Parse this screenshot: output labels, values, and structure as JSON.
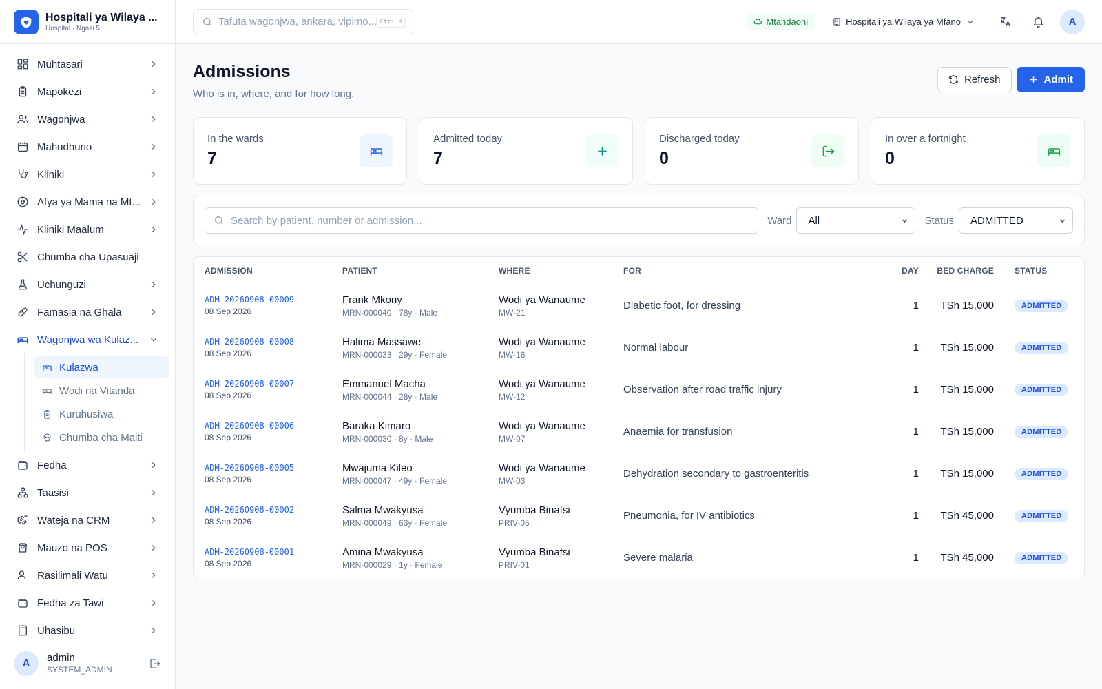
{
  "brand": {
    "title": "Hospitali ya Wilaya ...",
    "subtitle": "Hospital · Ngazi 5"
  },
  "sidebar": {
    "items": [
      {
        "label": "Muhtasari",
        "icon": "dashboard-icon"
      },
      {
        "label": "Mapokezi",
        "icon": "clipboard-icon"
      },
      {
        "label": "Wagonjwa",
        "icon": "users-icon"
      },
      {
        "label": "Mahudhurio",
        "icon": "calendar-icon"
      },
      {
        "label": "Kliniki",
        "icon": "stethoscope-icon"
      },
      {
        "label": "Afya ya Mama na Mt...",
        "icon": "baby-icon"
      },
      {
        "label": "Kliniki Maalum",
        "icon": "activity-icon"
      },
      {
        "label": "Chumba cha Upasuaji",
        "icon": "scissors-icon"
      },
      {
        "label": "Uchunguzi",
        "icon": "flask-icon"
      },
      {
        "label": "Famasia na Ghala",
        "icon": "pill-icon"
      },
      {
        "label": "Wagonjwa wa Kulaz...",
        "icon": "bed-icon"
      }
    ],
    "subitems": [
      {
        "label": "Kulazwa",
        "icon": "bed-icon"
      },
      {
        "label": "Wodi na Vitanda",
        "icon": "bed-icon"
      },
      {
        "label": "Kuruhusiwa",
        "icon": "clipboard-icon"
      },
      {
        "label": "Chumba cha Maiti",
        "icon": "skull-icon"
      }
    ],
    "items_after": [
      {
        "label": "Fedha",
        "icon": "wallet-icon"
      },
      {
        "label": "Taasisi",
        "icon": "network-icon"
      },
      {
        "label": "Wateja na CRM",
        "icon": "handshake-icon"
      },
      {
        "label": "Mauzo na POS",
        "icon": "shopping-bag-icon"
      },
      {
        "label": "Rasilimali Watu",
        "icon": "user-icon"
      },
      {
        "label": "Fedha za Tawi",
        "icon": "wallet-icon"
      },
      {
        "label": "Uhasibu",
        "icon": "calculator-icon"
      }
    ]
  },
  "user": {
    "initial": "A",
    "name": "admin",
    "role": "SYSTEM_ADMIN"
  },
  "topbar": {
    "search_placeholder": "Tafuta wagonjwa, ankara, vipimo...",
    "shortcut": "Ctrl K",
    "online_status": "Mtandaoni",
    "facility": "Hospitali ya Wilaya ya Mfano",
    "avatar_initial": "A"
  },
  "page": {
    "title": "Admissions",
    "subtitle": "Who is in, where, and for how long.",
    "refresh_label": "Refresh",
    "admit_label": "Admit"
  },
  "stats": [
    {
      "label": "In the wards",
      "value": "7",
      "icon": "bed-icon",
      "tone": "blue"
    },
    {
      "label": "Admitted today",
      "value": "7",
      "icon": "plus-icon",
      "tone": "teal"
    },
    {
      "label": "Discharged today",
      "value": "0",
      "icon": "log-out-icon",
      "tone": "green"
    },
    {
      "label": "In over a fortnight",
      "value": "0",
      "icon": "bed-icon",
      "tone": "green2"
    }
  ],
  "filters": {
    "search_placeholder": "Search by patient, number or admission...",
    "ward_label": "Ward",
    "ward_value": "All",
    "status_label": "Status",
    "status_value": "ADMITTED"
  },
  "table": {
    "columns": [
      "ADMISSION",
      "PATIENT",
      "WHERE",
      "FOR",
      "DAY",
      "BED CHARGE",
      "STATUS"
    ],
    "rows": [
      {
        "admission": "ADM-20260908-00009",
        "date": "08 Sep 2026",
        "patient": "Frank Mkony",
        "meta": "MRN-000040 · 78y · Male",
        "ward": "Wodi ya Wanaume",
        "bed": "MW-21",
        "for": "Diabetic foot, for dressing",
        "day": "1",
        "charge": "TSh 15,000",
        "status": "ADMITTED"
      },
      {
        "admission": "ADM-20260908-00008",
        "date": "08 Sep 2026",
        "patient": "Halima Massawe",
        "meta": "MRN-000033 · 29y · Female",
        "ward": "Wodi ya Wanaume",
        "bed": "MW-16",
        "for": "Normal labour",
        "day": "1",
        "charge": "TSh 15,000",
        "status": "ADMITTED"
      },
      {
        "admission": "ADM-20260908-00007",
        "date": "08 Sep 2026",
        "patient": "Emmanuel Macha",
        "meta": "MRN-000044 · 28y · Male",
        "ward": "Wodi ya Wanaume",
        "bed": "MW-12",
        "for": "Observation after road traffic injury",
        "day": "1",
        "charge": "TSh 15,000",
        "status": "ADMITTED"
      },
      {
        "admission": "ADM-20260908-00006",
        "date": "08 Sep 2026",
        "patient": "Baraka Kimaro",
        "meta": "MRN-000030 · 8y · Male",
        "ward": "Wodi ya Wanaume",
        "bed": "MW-07",
        "for": "Anaemia for transfusion",
        "day": "1",
        "charge": "TSh 15,000",
        "status": "ADMITTED"
      },
      {
        "admission": "ADM-20260908-00005",
        "date": "08 Sep 2026",
        "patient": "Mwajuma Kileo",
        "meta": "MRN-000047 · 49y · Female",
        "ward": "Wodi ya Wanaume",
        "bed": "MW-03",
        "for": "Dehydration secondary to gastroenteritis",
        "day": "1",
        "charge": "TSh 15,000",
        "status": "ADMITTED"
      },
      {
        "admission": "ADM-20260908-00002",
        "date": "08 Sep 2026",
        "patient": "Salma Mwakyusa",
        "meta": "MRN-000049 · 63y · Female",
        "ward": "Vyumba Binafsi",
        "bed": "PRIV-05",
        "for": "Pneumonia, for IV antibiotics",
        "day": "1",
        "charge": "TSh 45,000",
        "status": "ADMITTED"
      },
      {
        "admission": "ADM-20260908-00001",
        "date": "08 Sep 2026",
        "patient": "Amina Mwakyusa",
        "meta": "MRN-000029 · 1y · Female",
        "ward": "Vyumba Binafsi",
        "bed": "PRIV-01",
        "for": "Severe malaria",
        "day": "1",
        "charge": "TSh 45,000",
        "status": "ADMITTED"
      }
    ]
  },
  "colors": {
    "accent": "#2563eb",
    "online": "#15803d",
    "badge_bg": "#dbeafe"
  }
}
